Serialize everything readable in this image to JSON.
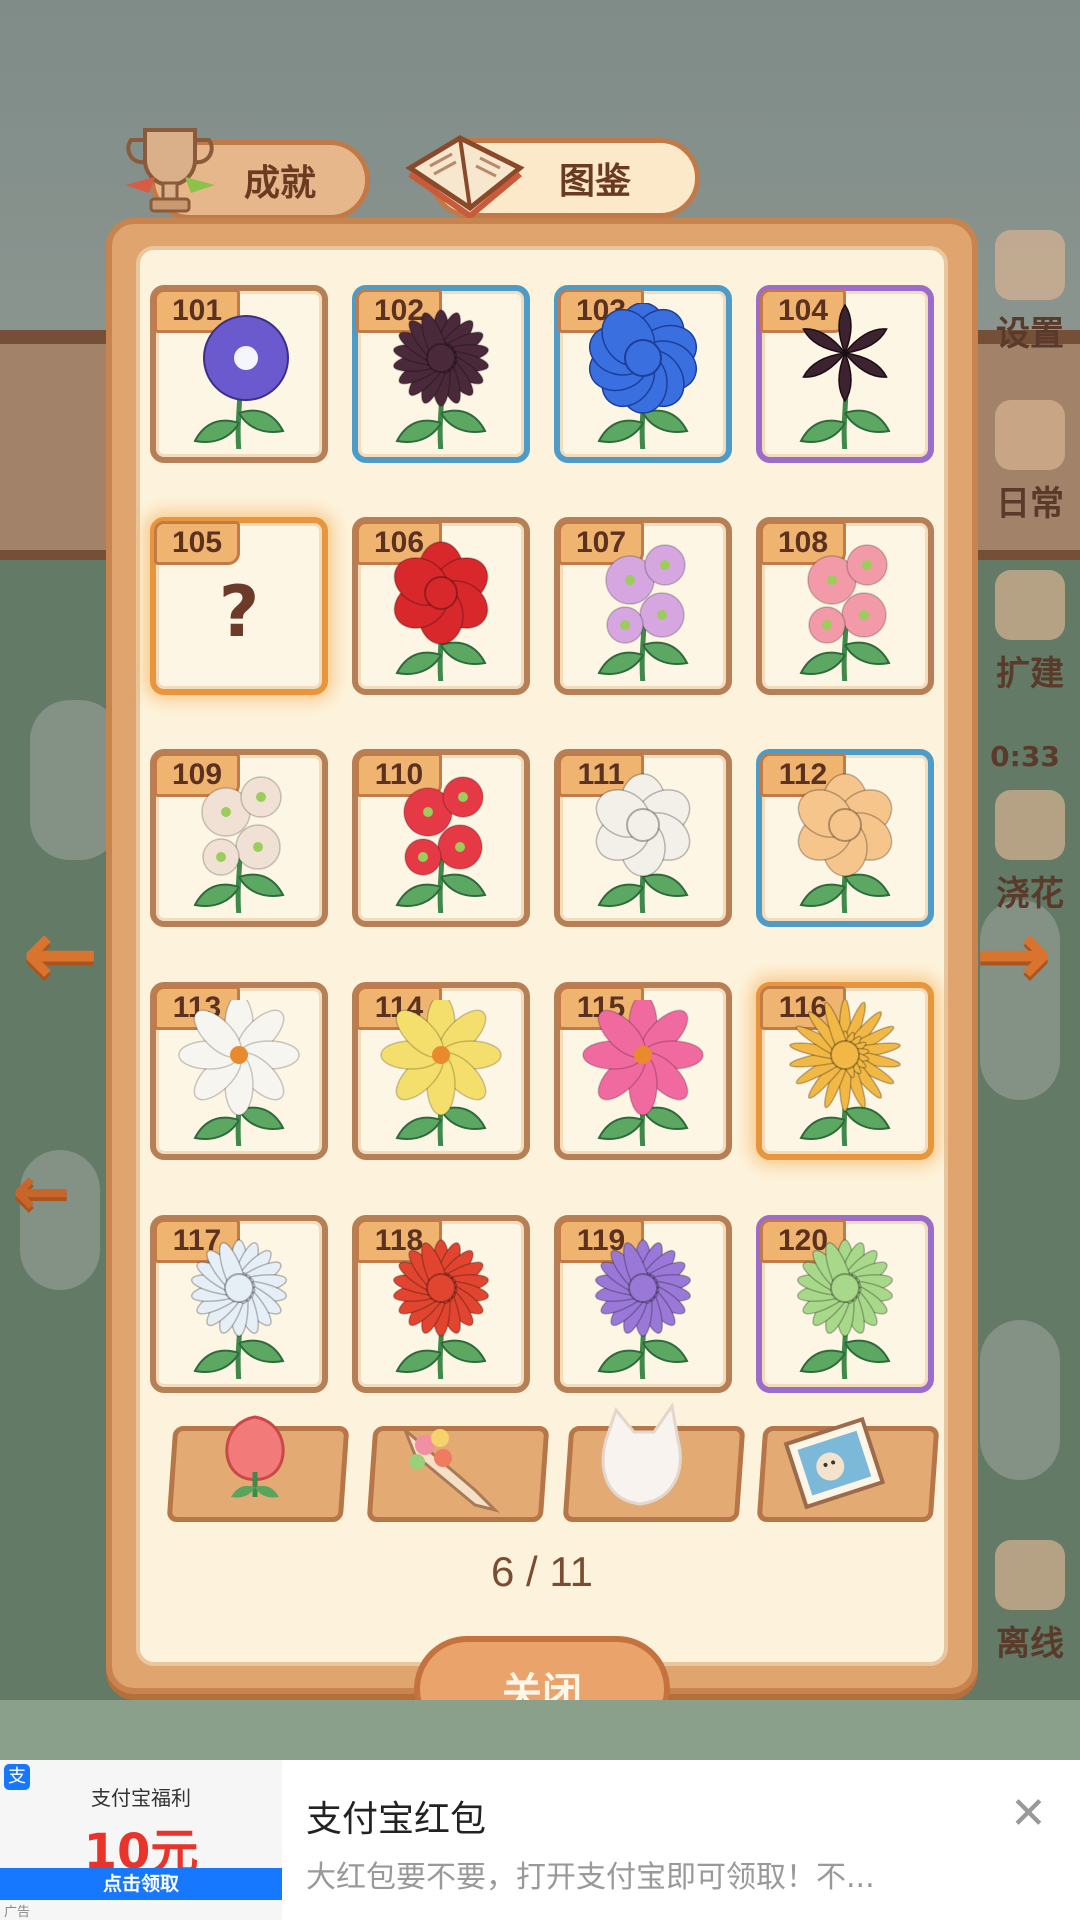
{
  "tabs": {
    "achievement": "成就",
    "album": "图鉴"
  },
  "side_menu": [
    "设置",
    "日常",
    "扩建",
    "浇花",
    "离线"
  ],
  "side_counter": "0:33",
  "cards": [
    {
      "num": "101",
      "frame": "normal",
      "flower": "morning-glory",
      "color": "#6a5acd"
    },
    {
      "num": "102",
      "frame": "blue",
      "flower": "chrysanthemum",
      "color": "#4a2a3a"
    },
    {
      "num": "103",
      "frame": "blue",
      "flower": "peony",
      "color": "#3a6fe0"
    },
    {
      "num": "104",
      "frame": "purple",
      "flower": "lily",
      "color": "#3d2230"
    },
    {
      "num": "105",
      "frame": "gold",
      "flower": "unknown",
      "color": "",
      "label": "?"
    },
    {
      "num": "106",
      "frame": "normal",
      "flower": "rose",
      "color": "#d8282c"
    },
    {
      "num": "107",
      "frame": "normal",
      "flower": "hollyhock",
      "color": "#d5a6e0"
    },
    {
      "num": "108",
      "frame": "normal",
      "flower": "hollyhock",
      "color": "#f29aa8"
    },
    {
      "num": "109",
      "frame": "normal",
      "flower": "hollyhock",
      "color": "#f0e1d4"
    },
    {
      "num": "110",
      "frame": "normal",
      "flower": "hollyhock",
      "color": "#e63946"
    },
    {
      "num": "111",
      "frame": "normal",
      "flower": "gardenia",
      "color": "#f3f0ea"
    },
    {
      "num": "112",
      "frame": "blue",
      "flower": "gardenia",
      "color": "#f6c58c"
    },
    {
      "num": "113",
      "frame": "normal",
      "flower": "cosmos",
      "color": "#f7f5f0"
    },
    {
      "num": "114",
      "frame": "normal",
      "flower": "cosmos",
      "color": "#f5df6c"
    },
    {
      "num": "115",
      "frame": "normal",
      "flower": "cosmos",
      "color": "#f06aa0"
    },
    {
      "num": "116",
      "frame": "gold",
      "flower": "spider-mum",
      "color": "#f2b845"
    },
    {
      "num": "117",
      "frame": "normal",
      "flower": "chrysanthemum",
      "color": "#e6eef6"
    },
    {
      "num": "118",
      "frame": "normal",
      "flower": "chrysanthemum",
      "color": "#e2452f"
    },
    {
      "num": "119",
      "frame": "normal",
      "flower": "chrysanthemum",
      "color": "#9a78d8"
    },
    {
      "num": "120",
      "frame": "purple",
      "flower": "chrysanthemum",
      "color": "#a8d88a"
    }
  ],
  "categories": [
    "rose-icon",
    "bouquet-icon",
    "cat-silhouette-icon",
    "photo-icon"
  ],
  "pager": "6 / 11",
  "close_label": "关闭",
  "ad": {
    "image_title": "支付宝福利",
    "image_amount": "10元",
    "image_cta": "点击领取",
    "title": "支付宝红包",
    "description": "大红包要不要，打开支付宝即可领取！不...",
    "ad_label": "广告"
  }
}
